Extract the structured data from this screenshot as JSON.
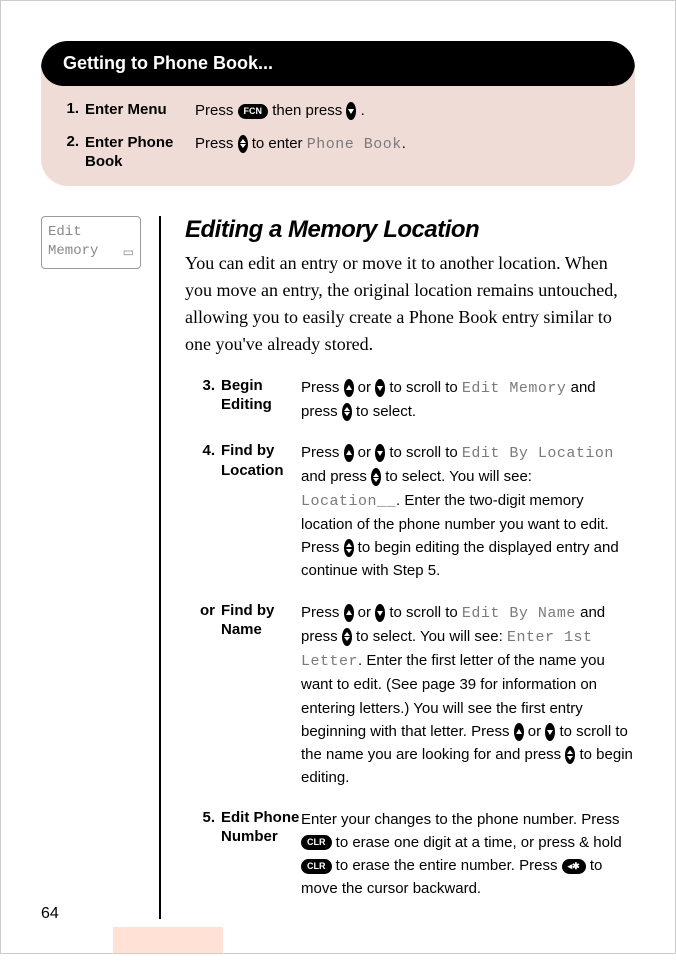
{
  "panel": {
    "title": "Getting to Phone Book...",
    "steps": [
      {
        "num": "1.",
        "label": "Enter Menu",
        "pre": "Press ",
        "key1": "FCN",
        "mid": " then press ",
        "post": "."
      },
      {
        "num": "2.",
        "label": "Enter Phone Book",
        "pre": "Press ",
        "mid": " to enter ",
        "lcd": "Phone Book",
        "post": "."
      }
    ]
  },
  "sidebar": {
    "line1": "Edit",
    "line2": "Memory"
  },
  "article": {
    "title": "Editing a Memory Location",
    "intro": "You can edit an entry or move it to another location. When you move an entry, the original location remains untouched, allowing you to easily create a Phone Book entry similar to one you've already stored."
  },
  "proc": [
    {
      "num": "3.",
      "label": "Begin Editing",
      "t1": "Press ",
      "t2": " or ",
      "t3": " to scroll to ",
      "lcd1": "Edit Memory",
      "t4": " and press ",
      "t5": " to select."
    },
    {
      "num": "4.",
      "label": "Find by Location",
      "t1": "Press ",
      "t2": " or ",
      "t3": " to scroll to ",
      "lcd1": "Edit By Location",
      "t4": " and press ",
      "t5": " to select. You will see: ",
      "lcd2": "Location__",
      "t6": ". Enter the two-digit memory location of the phone number you want to edit. Press ",
      "t7": " to begin editing the displayed entry and continue with Step 5."
    },
    {
      "num": "or",
      "label": "Find by Name",
      "t1": "Press ",
      "t2": " or ",
      "t3": " to scroll to ",
      "lcd1": "Edit By Name",
      "t4": " and press ",
      "t5": " to select. You will see: ",
      "lcd2": "Enter 1st Letter",
      "t6": ". Enter the first letter of the name you want to edit. (See page 39 for information on entering letters.) You will see the first entry beginning with that letter. Press ",
      "t7": " or ",
      "t8": " to scroll to the name you are looking for and press ",
      "t9": " to begin editing."
    },
    {
      "num": "5.",
      "label": "Edit Phone Number",
      "t1": "Enter your changes to the phone number. Press ",
      "key1": "CLR",
      "t2": " to erase one digit at a time, or press & hold ",
      "key2": "CLR",
      "t3": " to erase the entire number. Press ",
      "key3": "◂✱",
      "t4": " to move the cursor backward."
    }
  ],
  "pageNumber": "64"
}
